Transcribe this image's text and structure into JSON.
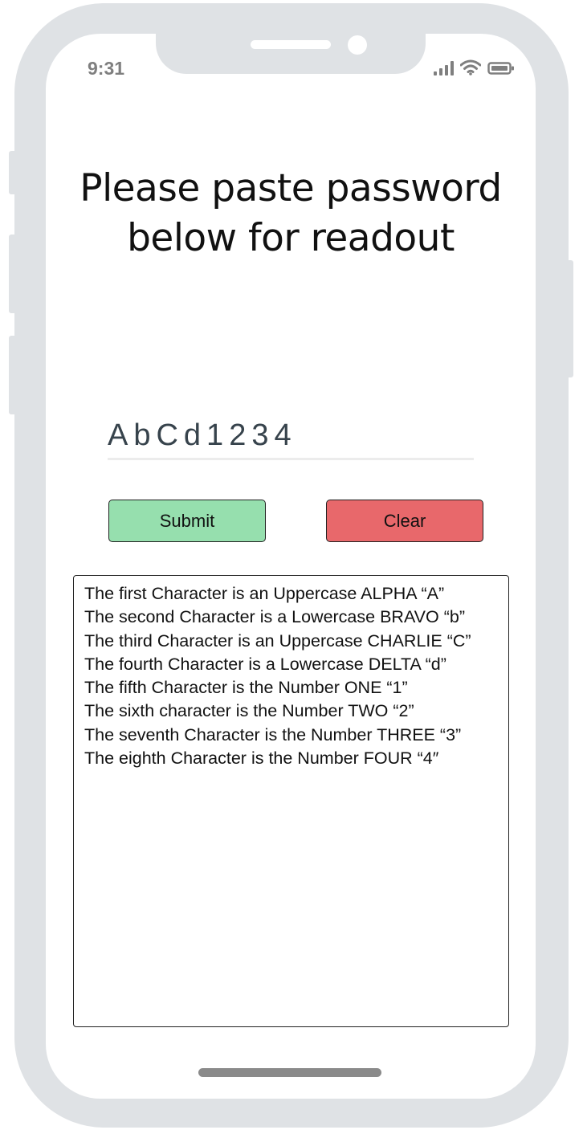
{
  "status_bar": {
    "time": "9:31",
    "icons": [
      "signal-icon",
      "wifi-icon",
      "battery-icon"
    ]
  },
  "main": {
    "title_line1": "Please paste password",
    "title_line2": "below for readout",
    "password_value": "AbCd1234",
    "submit_label": "Submit",
    "clear_label": "Clear",
    "readout_lines": [
      "The first Character is an Uppercase ALPHA “A”",
      "The second Character is a Lowercase BRAVO “b”",
      "The third Character is an Uppercase CHARLIE “C”",
      "The fourth Character is a Lowercase DELTA “d”",
      "The fifth Character is the Number ONE “1”",
      "The sixth character is the Number TWO “2”",
      "The seventh Character is the Number THREE “3”",
      "The eighth Character is the Number FOUR “4″"
    ]
  },
  "colors": {
    "frame": "#dfe2e5",
    "submit": "#96dfae",
    "clear": "#e8686b",
    "input_text": "#37434c"
  }
}
